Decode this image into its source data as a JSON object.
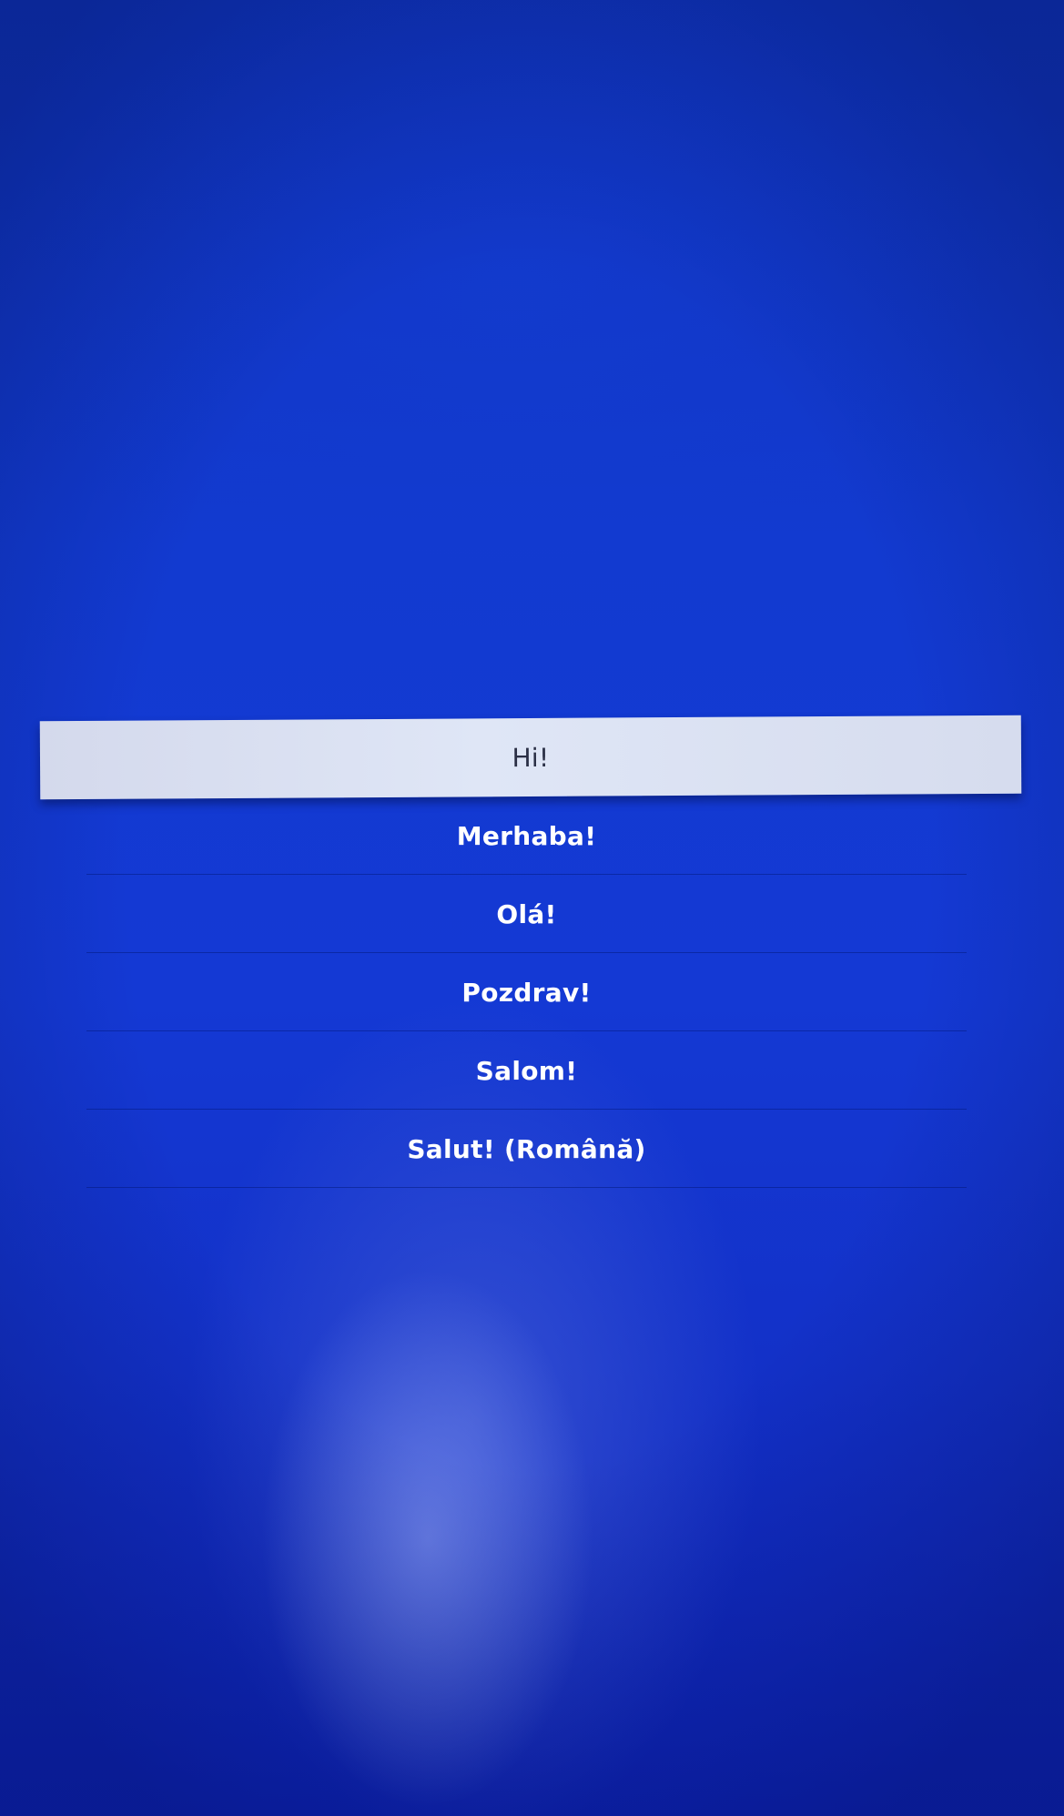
{
  "screen": {
    "background_color": "#1033c4",
    "selected_index": 0
  },
  "greetings": [
    {
      "label": "Hi!"
    },
    {
      "label": "Merhaba!"
    },
    {
      "label": "Olá!"
    },
    {
      "label": "Pozdrav!"
    },
    {
      "label": "Salom!"
    },
    {
      "label": "Salut! (Română)"
    }
  ]
}
